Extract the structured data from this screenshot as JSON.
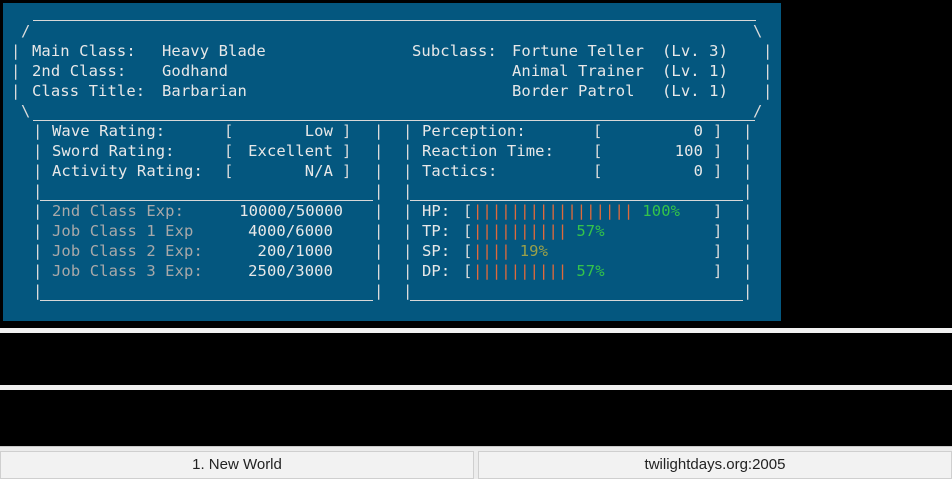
{
  "main_class_label": "Main Class:",
  "main_class": "Heavy Blade",
  "second_class_label": "2nd Class:",
  "second_class": "Godhand",
  "class_title_label": "Class Title:",
  "class_title": "Barbarian",
  "subclass_label": "Subclass:",
  "subclasses": [
    {
      "name": "Fortune Teller",
      "level": "(Lv. 3)"
    },
    {
      "name": "Animal Trainer",
      "level": "(Lv. 1)"
    },
    {
      "name": "Border Patrol",
      "level": "(Lv. 1)"
    }
  ],
  "ratings": [
    {
      "label": "Wave Rating:",
      "value": "Low"
    },
    {
      "label": "Sword Rating:",
      "value": "Excellent"
    },
    {
      "label": "Activity Rating:",
      "value": "N/A"
    }
  ],
  "skills": [
    {
      "label": "Perception:",
      "value": "0"
    },
    {
      "label": "Reaction Time:",
      "value": "100"
    },
    {
      "label": "Tactics:",
      "value": "0"
    }
  ],
  "exp": [
    {
      "label": "2nd Class Exp:",
      "value": "10000/50000"
    },
    {
      "label": "Job Class 1 Exp",
      "value": "4000/6000"
    },
    {
      "label": "Job Class 2 Exp:",
      "value": "200/1000"
    },
    {
      "label": "Job Class 3 Exp:",
      "value": "2500/3000"
    }
  ],
  "vitals": [
    {
      "label": "HP:",
      "bars": "|||||||||||||||||",
      "pct": "100%",
      "fraction": 1.0,
      "pct_color": "#34c34a"
    },
    {
      "label": "TP:",
      "bars": "||||||||||",
      "pct": "57%",
      "fraction": 0.57,
      "pct_color": "#34c34a"
    },
    {
      "label": "SP:",
      "bars": "||||",
      "pct": "19%",
      "fraction": 0.19,
      "pct_color": "#9aa04a"
    },
    {
      "label": "DP:",
      "bars": "||||||||||",
      "pct": "57%",
      "fraction": 0.57,
      "pct_color": "#34c34a"
    }
  ],
  "statusbar": {
    "session": "1. New World",
    "host": "twilightdays.org:2005"
  },
  "colors": {
    "terminal_bg": "#04577f",
    "bar": "#e06a3b",
    "good": "#34c34a"
  }
}
